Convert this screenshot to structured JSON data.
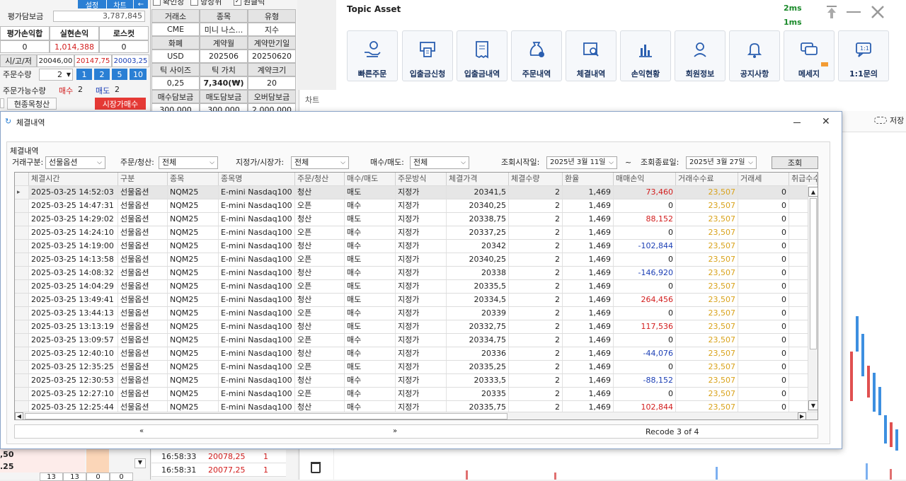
{
  "left_panel": {
    "top_buttons": [
      "설정",
      "차트",
      "←"
    ],
    "eval_margin_label": "평가담보금",
    "eval_margin_value": "3,787,845",
    "pl_headers": [
      "평가손익합",
      "실현손익",
      "로스컷"
    ],
    "pl_values": [
      "0",
      "1,014,388",
      "0"
    ],
    "ohl_label": "시/고/저",
    "ohl_values": [
      "20046,00",
      "20147,75",
      "20003,25"
    ],
    "order_qty_label": "주문수량",
    "order_qty_value": "2",
    "qty_buttons": [
      "1",
      "2",
      "5",
      "10"
    ],
    "avail_label": "주문가능수량",
    "buy_label": "매수",
    "buy_value": "2",
    "sell_label": "매도",
    "sell_value": "2",
    "liquidate_button": "현종목청산",
    "market_buy_button": "시장가매수",
    "price_rows": [
      ",50",
      ".25"
    ],
    "bottom_values": [
      "13",
      "13",
      "0",
      "0"
    ]
  },
  "checks": [
    "확인창",
    "항상위",
    "원클릭"
  ],
  "info_table": {
    "rows": [
      [
        "거래소",
        "종목",
        "유형"
      ],
      [
        "CME",
        "미니 나스...",
        "지수"
      ],
      [
        "화폐",
        "계약월",
        "계약만기일"
      ],
      [
        "USD",
        "202506",
        "20250620"
      ],
      [
        "틱 사이즈",
        "틱 가치",
        "계약크기"
      ],
      [
        "0,25",
        "7,340(₩)",
        "20"
      ],
      [
        "매수담보금",
        "매도담보금",
        "오버담보금"
      ],
      [
        "300,000",
        "300,000",
        "2,000,000"
      ]
    ]
  },
  "ticks": [
    {
      "time": "16:58:33",
      "price": "20078,25",
      "qty": "1"
    },
    {
      "time": "16:58:31",
      "price": "20077,25",
      "qty": "1"
    }
  ],
  "chart_tab": "차트",
  "save_label": "저장",
  "topic": {
    "title": "Topic Asset",
    "latency1": "2ms",
    "latency2": "1ms",
    "buttons": [
      {
        "label": "빠른주문",
        "icon": "hand-coin-icon"
      },
      {
        "label": "입출금신청",
        "icon": "atm-icon"
      },
      {
        "label": "입출금내역",
        "icon": "receipt-icon"
      },
      {
        "label": "주문내역",
        "icon": "money-bag-icon"
      },
      {
        "label": "체결내역",
        "icon": "search-doc-icon"
      },
      {
        "label": "손익현황",
        "icon": "bar-chart-icon"
      },
      {
        "label": "회원정보",
        "icon": "user-icon"
      },
      {
        "label": "공지사항",
        "icon": "bell-icon"
      },
      {
        "label": "메세지",
        "icon": "chat-icon"
      },
      {
        "label": "1:1문의",
        "icon": "chat-11-icon"
      }
    ]
  },
  "dialog": {
    "title": "체결내역",
    "group_label": "체결내역",
    "filters": {
      "trade_type_label": "거래구분:",
      "trade_type": "선물옵션",
      "order_clear_label": "주문/청산:",
      "order_clear": "전체",
      "limit_market_label": "지정가/시장가:",
      "limit_market": "전체",
      "buy_sell_label": "매수/매도:",
      "buy_sell": "전체",
      "start_label": "조회시작일:",
      "start_date": "2025년  3월 11일",
      "tilde": "~",
      "end_label": "조회종료일:",
      "end_date": "2025년  3월 27일",
      "search_button": "조회"
    },
    "columns": [
      "체결시간",
      "구분",
      "종목",
      "종목명",
      "주문/청산",
      "매수/매도",
      "주문방식",
      "체결가격",
      "체결수량",
      "환율",
      "매매손익",
      "거래수수료",
      "거래세",
      "취급수수"
    ],
    "rows": [
      [
        "2025-03-25  14:52:03",
        "선물옵션",
        "NQM25",
        "E-mini Nasdaq100",
        "청산",
        "매도",
        "지정가",
        "20341,5",
        "2",
        "1,469",
        "73,460",
        "23,507",
        "0"
      ],
      [
        "2025-03-25  14:47:31",
        "선물옵션",
        "NQM25",
        "E-mini Nasdaq100",
        "오픈",
        "매수",
        "지정가",
        "20340,25",
        "2",
        "1,469",
        "0",
        "23,507",
        "0"
      ],
      [
        "2025-03-25  14:29:02",
        "선물옵션",
        "NQM25",
        "E-mini Nasdaq100",
        "청산",
        "매도",
        "지정가",
        "20338,75",
        "2",
        "1,469",
        "88,152",
        "23,507",
        "0"
      ],
      [
        "2025-03-25  14:24:10",
        "선물옵션",
        "NQM25",
        "E-mini Nasdaq100",
        "오픈",
        "매수",
        "지정가",
        "20337,25",
        "2",
        "1,469",
        "0",
        "23,507",
        "0"
      ],
      [
        "2025-03-25  14:19:00",
        "선물옵션",
        "NQM25",
        "E-mini Nasdaq100",
        "청산",
        "매수",
        "지정가",
        "20342",
        "2",
        "1,469",
        "-102,844",
        "23,507",
        "0"
      ],
      [
        "2025-03-25  14:13:58",
        "선물옵션",
        "NQM25",
        "E-mini Nasdaq100",
        "오픈",
        "매도",
        "지정가",
        "20340,25",
        "2",
        "1,469",
        "0",
        "23,507",
        "0"
      ],
      [
        "2025-03-25  14:08:32",
        "선물옵션",
        "NQM25",
        "E-mini Nasdaq100",
        "청산",
        "매수",
        "지정가",
        "20338",
        "2",
        "1,469",
        "-146,920",
        "23,507",
        "0"
      ],
      [
        "2025-03-25  14:04:29",
        "선물옵션",
        "NQM25",
        "E-mini Nasdaq100",
        "오픈",
        "매도",
        "지정가",
        "20335,5",
        "2",
        "1,469",
        "0",
        "23,507",
        "0"
      ],
      [
        "2025-03-25  13:49:41",
        "선물옵션",
        "NQM25",
        "E-mini Nasdaq100",
        "청산",
        "매도",
        "지정가",
        "20334,5",
        "2",
        "1,469",
        "264,456",
        "23,507",
        "0"
      ],
      [
        "2025-03-25  13:44:13",
        "선물옵션",
        "NQM25",
        "E-mini Nasdaq100",
        "오픈",
        "매수",
        "지정가",
        "20339",
        "2",
        "1,469",
        "0",
        "23,507",
        "0"
      ],
      [
        "2025-03-25  13:13:19",
        "선물옵션",
        "NQM25",
        "E-mini Nasdaq100",
        "청산",
        "매도",
        "지정가",
        "20332,75",
        "2",
        "1,469",
        "117,536",
        "23,507",
        "0"
      ],
      [
        "2025-03-25  13:09:57",
        "선물옵션",
        "NQM25",
        "E-mini Nasdaq100",
        "오픈",
        "매수",
        "지정가",
        "20334,75",
        "2",
        "1,469",
        "0",
        "23,507",
        "0"
      ],
      [
        "2025-03-25  12:40:10",
        "선물옵션",
        "NQM25",
        "E-mini Nasdaq100",
        "청산",
        "매수",
        "지정가",
        "20336",
        "2",
        "1,469",
        "-44,076",
        "23,507",
        "0"
      ],
      [
        "2025-03-25  12:35:25",
        "선물옵션",
        "NQM25",
        "E-mini Nasdaq100",
        "오픈",
        "매도",
        "지정가",
        "20335,25",
        "2",
        "1,469",
        "0",
        "23,507",
        "0"
      ],
      [
        "2025-03-25  12:30:53",
        "선물옵션",
        "NQM25",
        "E-mini Nasdaq100",
        "청산",
        "매수",
        "지정가",
        "20333,5",
        "2",
        "1,469",
        "-88,152",
        "23,507",
        "0"
      ],
      [
        "2025-03-25  12:27:10",
        "선물옵션",
        "NQM25",
        "E-mini Nasdaq100",
        "오픈",
        "매수",
        "지정가",
        "20335",
        "2",
        "1,469",
        "0",
        "23,507",
        "0"
      ],
      [
        "2025-03-25  12:25:44",
        "선물옵션",
        "NQM25",
        "E-mini Nasdaq100",
        "청산",
        "매수",
        "지정가",
        "20335,75",
        "2",
        "1,469",
        "102,844",
        "23,507",
        "0"
      ]
    ],
    "pager_prev": "«",
    "pager_next": "»",
    "recode": "Recode 3 of 4"
  }
}
